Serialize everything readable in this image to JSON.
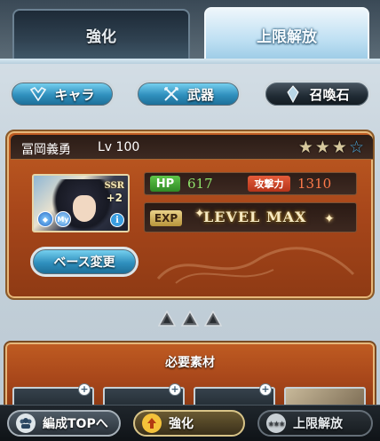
{
  "tabs": {
    "enhance": "強化",
    "limit_break": "上限解放"
  },
  "categories": {
    "chara": "キャラ",
    "weapon": "武器",
    "summon": "召喚石"
  },
  "character": {
    "name": "冨岡義勇",
    "level": "Lv 100",
    "stars_total": 4,
    "stars_filled": 3,
    "rarity": "SSR",
    "plus": "+2",
    "my_badge": "My",
    "hp_label": "HP",
    "hp_value": "617",
    "atk_label": "攻撃力",
    "atk_value": "1310",
    "exp_label": "EXP",
    "level_max": "LEVEL MAX",
    "base_change": "ベース変更"
  },
  "uncap_markers": 3,
  "materials": {
    "title": "必要素材"
  },
  "bottom_bar": {
    "party_top": "編成TOPへ",
    "enhance": "強化",
    "limit_break": "上限解放"
  },
  "colors": {
    "panel": "#a7461a",
    "button_blue": "#2f8fbd",
    "hp_green": "#8fe36a",
    "atk_red": "#ff7a4a"
  }
}
